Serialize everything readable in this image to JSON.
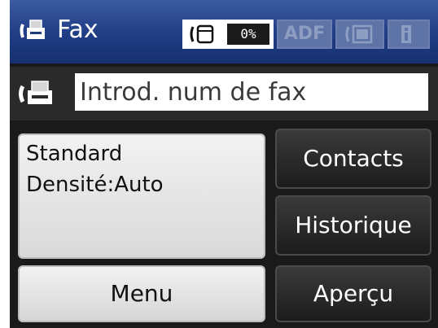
{
  "header": {
    "title": "Fax",
    "icon": "fax-machine-icon",
    "status": {
      "memory_icon": "memory-card-icon",
      "memory_level": "0%",
      "adf_label": "ADF",
      "sheet_icon": "sheet-icon",
      "info_icon": "info-icon"
    }
  },
  "fax_number": {
    "icon": "fax-machine-icon",
    "placeholder": "Introd. num de fax",
    "value": ""
  },
  "settings": {
    "line1": "Standard",
    "line2": "Densité:Auto"
  },
  "buttons": {
    "contacts": "Contacts",
    "history": "Historique",
    "menu": "Menu",
    "preview": "Aperçu"
  },
  "colors": {
    "header_blue": "#1e3a82",
    "dark_button": "#1c1c1c",
    "light_button": "#e6e6e6"
  }
}
